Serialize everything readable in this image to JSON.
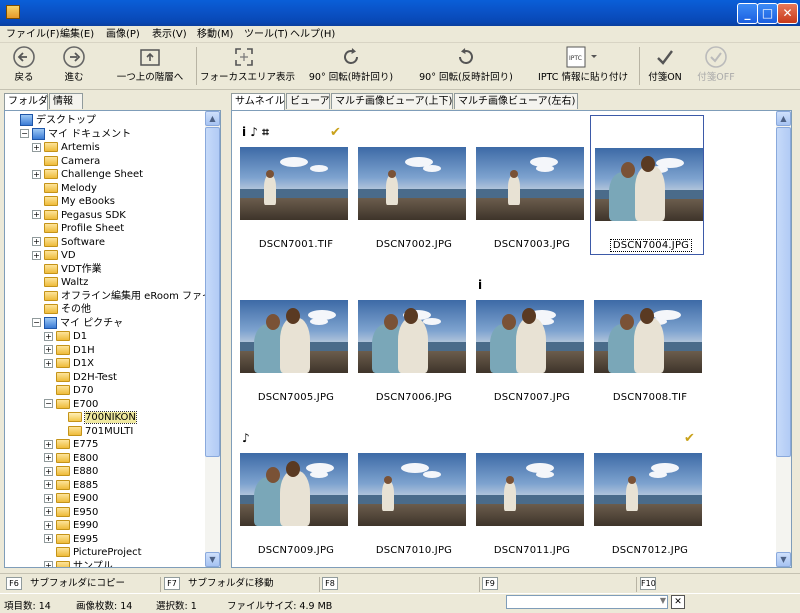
{
  "menu": [
    "ファイル(F)",
    "編集(E)",
    "画像(P)",
    "表示(V)",
    "移動(M)",
    "ツール(T)",
    "ヘルプ(H)"
  ],
  "toolbar": {
    "back": "戻る",
    "forward": "進む",
    "up": "一つ上の階層へ",
    "focus": "フォーカスエリア表示",
    "rotate_cw": "90° 回転(時計回り)",
    "rotate_ccw": "90° 回転(反時計回り)",
    "iptc": "IPTC 情報に貼り付け",
    "tag_on": "付箋ON",
    "tag_off": "付箋OFF",
    "iptc_icon_text": "IPTC"
  },
  "left_tabs": [
    "フォルダ",
    "情報"
  ],
  "right_tabs": [
    "サムネイル",
    "ビューア",
    "マルチ画像ビューア(上下)",
    "マルチ画像ビューア(左右)"
  ],
  "tree": [
    {
      "label": "デスクトップ",
      "level": 0,
      "exp": "",
      "icon": "desktop"
    },
    {
      "label": "マイ ドキュメント",
      "level": 1,
      "exp": "−",
      "icon": "docs"
    },
    {
      "label": "Artemis",
      "level": 2,
      "exp": "+",
      "icon": "folder"
    },
    {
      "label": "Camera",
      "level": 2,
      "exp": "",
      "icon": "folder"
    },
    {
      "label": "Challenge Sheet",
      "level": 2,
      "exp": "+",
      "icon": "folder"
    },
    {
      "label": "Melody",
      "level": 2,
      "exp": "",
      "icon": "folder"
    },
    {
      "label": "My eBooks",
      "level": 2,
      "exp": "",
      "icon": "folder"
    },
    {
      "label": "Pegasus SDK",
      "level": 2,
      "exp": "+",
      "icon": "folder"
    },
    {
      "label": "Profile Sheet",
      "level": 2,
      "exp": "",
      "icon": "folder"
    },
    {
      "label": "Software",
      "level": 2,
      "exp": "+",
      "icon": "folder"
    },
    {
      "label": "VD",
      "level": 2,
      "exp": "+",
      "icon": "folder"
    },
    {
      "label": "VDT作業",
      "level": 2,
      "exp": "",
      "icon": "folder"
    },
    {
      "label": "Waltz",
      "level": 2,
      "exp": "",
      "icon": "folder"
    },
    {
      "label": "オフライン編集用 eRoom ファイル",
      "level": 2,
      "exp": "",
      "icon": "folder"
    },
    {
      "label": "その他",
      "level": 2,
      "exp": "",
      "icon": "folder"
    },
    {
      "label": "マイ ピクチャ",
      "level": 2,
      "exp": "−",
      "icon": "pictures"
    },
    {
      "label": "D1",
      "level": 3,
      "exp": "+",
      "icon": "folder"
    },
    {
      "label": "D1H",
      "level": 3,
      "exp": "+",
      "icon": "folder"
    },
    {
      "label": "D1X",
      "level": 3,
      "exp": "+",
      "icon": "folder"
    },
    {
      "label": "D2H-Test",
      "level": 3,
      "exp": "",
      "icon": "folder"
    },
    {
      "label": "D70",
      "level": 3,
      "exp": "",
      "icon": "folder"
    },
    {
      "label": "E700",
      "level": 3,
      "exp": "−",
      "icon": "folder"
    },
    {
      "label": "700NIKON",
      "level": 4,
      "exp": "",
      "icon": "folder-open",
      "selected": true
    },
    {
      "label": "701MULTI",
      "level": 4,
      "exp": "",
      "icon": "folder"
    },
    {
      "label": "E775",
      "level": 3,
      "exp": "+",
      "icon": "folder"
    },
    {
      "label": "E800",
      "level": 3,
      "exp": "+",
      "icon": "folder"
    },
    {
      "label": "E880",
      "level": 3,
      "exp": "+",
      "icon": "folder"
    },
    {
      "label": "E885",
      "level": 3,
      "exp": "+",
      "icon": "folder"
    },
    {
      "label": "E900",
      "level": 3,
      "exp": "+",
      "icon": "folder"
    },
    {
      "label": "E950",
      "level": 3,
      "exp": "+",
      "icon": "folder"
    },
    {
      "label": "E990",
      "level": 3,
      "exp": "+",
      "icon": "folder"
    },
    {
      "label": "E995",
      "level": 3,
      "exp": "+",
      "icon": "folder"
    },
    {
      "label": "PictureProject",
      "level": 3,
      "exp": "",
      "icon": "folder"
    },
    {
      "label": "サンプル",
      "level": 3,
      "exp": "+",
      "icon": "folder"
    }
  ],
  "thumbnails": [
    {
      "name": "DSCN7001.TIF",
      "scene": "solo",
      "badges": "i ♪ ⌗",
      "check": true
    },
    {
      "name": "DSCN7002.JPG",
      "scene": "solo",
      "badges": "",
      "check": false
    },
    {
      "name": "DSCN7003.JPG",
      "scene": "solo",
      "badges": "",
      "check": false
    },
    {
      "name": "DSCN7004.JPG",
      "scene": "couple",
      "badges": "",
      "check": false,
      "selected": true
    },
    {
      "name": "DSCN7005.JPG",
      "scene": "couple",
      "badges": "",
      "check": false
    },
    {
      "name": "DSCN7006.JPG",
      "scene": "couple",
      "badges": "",
      "check": false
    },
    {
      "name": "DSCN7007.JPG",
      "scene": "couple",
      "badges": "i",
      "check": false
    },
    {
      "name": "DSCN7008.TIF",
      "scene": "couple",
      "badges": "",
      "check": false
    },
    {
      "name": "DSCN7009.JPG",
      "scene": "couple",
      "badges": "♪",
      "check": false
    },
    {
      "name": "DSCN7010.JPG",
      "scene": "solo",
      "badges": "",
      "check": false
    },
    {
      "name": "DSCN7011.JPG",
      "scene": "solo",
      "badges": "",
      "check": false
    },
    {
      "name": "DSCN7012.JPG",
      "scene": "solo",
      "badges": "",
      "check": true
    }
  ],
  "fkeys": [
    {
      "key": "F6",
      "label": "サブフォルダにコピー"
    },
    {
      "key": "F7",
      "label": "サブフォルダに移動"
    },
    {
      "key": "F8",
      "label": ""
    },
    {
      "key": "F9",
      "label": ""
    },
    {
      "key": "F10",
      "label": ""
    }
  ],
  "status": {
    "items": "項目数: 14",
    "images": "画像枚数: 14",
    "selected": "選択数: 1",
    "filesize": "ファイルサイズ: 4.9 MB"
  },
  "window_buttons": {
    "min": "_",
    "max": "□",
    "close": "✕"
  },
  "colors": {
    "titlebar": "#0a53c8",
    "accent": "#3d5aa8",
    "check": "#c9a21b"
  }
}
